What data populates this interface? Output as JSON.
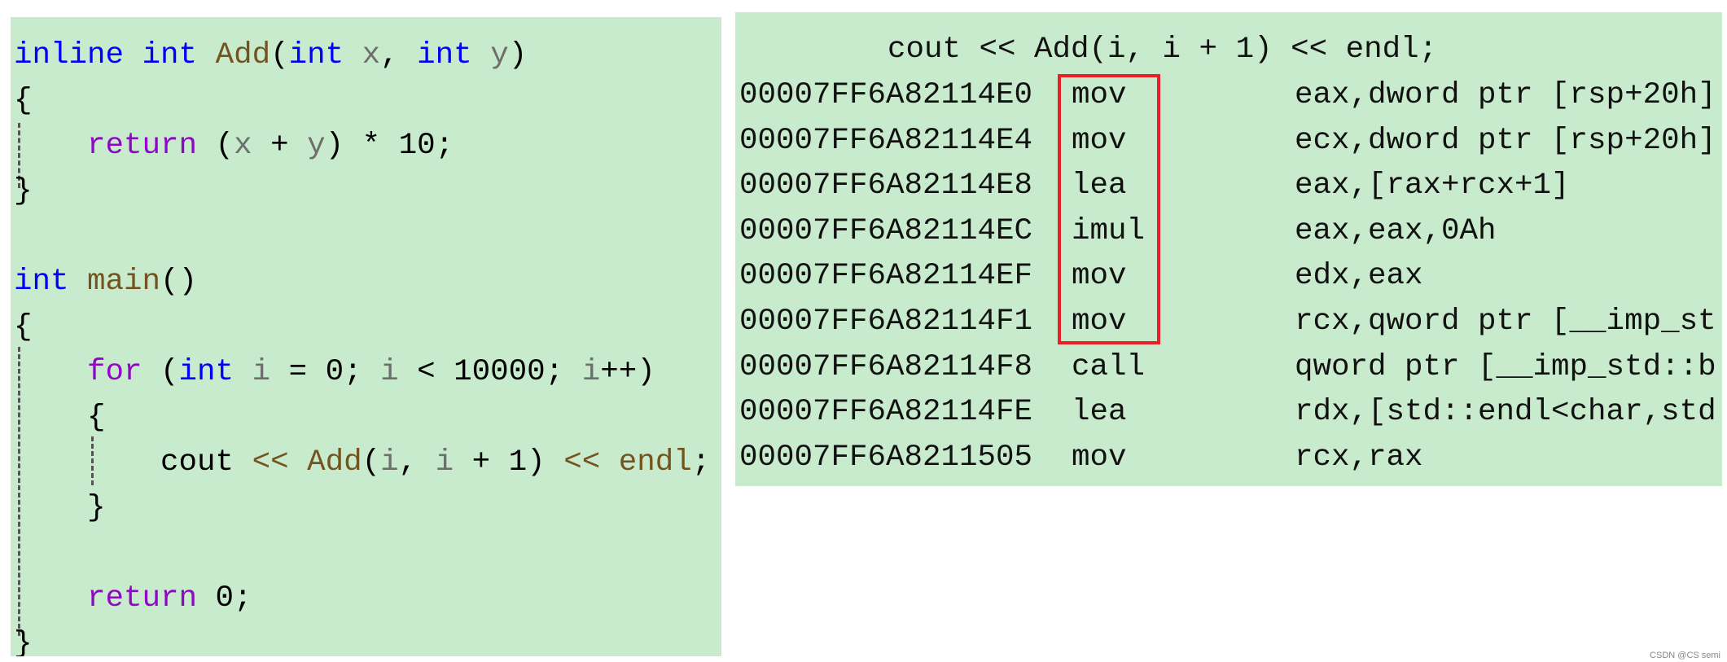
{
  "colors": {
    "background": "#c7ebcc",
    "keyword": "#0000ff",
    "function": "#74531f",
    "control": "#8f08c4",
    "parameter": "#6e6e6e",
    "highlight_box": "#e8202a"
  },
  "source_code": {
    "lines": [
      [
        [
          "inline",
          "kw"
        ],
        [
          " ",
          "pl"
        ],
        [
          "int",
          "kw"
        ],
        [
          " ",
          "pl"
        ],
        [
          "Add",
          "fn"
        ],
        [
          "(",
          "pl"
        ],
        [
          "int",
          "kw"
        ],
        [
          " ",
          "pl"
        ],
        [
          "x",
          "par"
        ],
        [
          ", ",
          "pl"
        ],
        [
          "int",
          "kw"
        ],
        [
          " ",
          "pl"
        ],
        [
          "y",
          "par"
        ],
        [
          ")",
          "pl"
        ]
      ],
      [
        [
          "{",
          "pl"
        ]
      ],
      [
        [
          "    ",
          "pl"
        ],
        [
          "return",
          "ctl"
        ],
        [
          " (",
          "pl"
        ],
        [
          "x",
          "par"
        ],
        [
          " + ",
          "pl"
        ],
        [
          "y",
          "par"
        ],
        [
          ") * 10;",
          "pl"
        ]
      ],
      [
        [
          "}",
          "pl"
        ]
      ],
      [],
      [
        [
          "int",
          "kw"
        ],
        [
          " ",
          "pl"
        ],
        [
          "main",
          "fn"
        ],
        [
          "()",
          "pl"
        ]
      ],
      [
        [
          "{",
          "pl"
        ]
      ],
      [
        [
          "    ",
          "pl"
        ],
        [
          "for",
          "ctl"
        ],
        [
          " (",
          "pl"
        ],
        [
          "int",
          "kw"
        ],
        [
          " ",
          "pl"
        ],
        [
          "i",
          "var"
        ],
        [
          " = 0; ",
          "pl"
        ],
        [
          "i",
          "var"
        ],
        [
          " < 10000; ",
          "pl"
        ],
        [
          "i",
          "var"
        ],
        [
          "++)",
          "pl"
        ]
      ],
      [
        [
          "    {",
          "pl"
        ]
      ],
      [
        [
          "        cout ",
          "pl"
        ],
        [
          "<<",
          "fn"
        ],
        [
          " ",
          "pl"
        ],
        [
          "Add",
          "fn"
        ],
        [
          "(",
          "pl"
        ],
        [
          "i",
          "var"
        ],
        [
          ", ",
          "pl"
        ],
        [
          "i",
          "var"
        ],
        [
          " + 1) ",
          "pl"
        ],
        [
          "<<",
          "fn"
        ],
        [
          " ",
          "pl"
        ],
        [
          "endl",
          "fn"
        ],
        [
          ";",
          "pl"
        ]
      ],
      [
        [
          "    }",
          "pl"
        ]
      ],
      [],
      [
        [
          "    ",
          "pl"
        ],
        [
          "return",
          "ctl"
        ],
        [
          " 0;",
          "pl"
        ]
      ],
      [
        [
          "}",
          "pl"
        ]
      ]
    ]
  },
  "disassembly": {
    "partial_line": "{",
    "source_line": "cout << Add(i, i + 1) << endl;",
    "rows": [
      {
        "address": "00007FF6A82114E0",
        "mnemonic": "mov",
        "operands": "eax,dword ptr [rsp+20h]"
      },
      {
        "address": "00007FF6A82114E4",
        "mnemonic": "mov",
        "operands": "ecx,dword ptr [rsp+20h]"
      },
      {
        "address": "00007FF6A82114E8",
        "mnemonic": "lea",
        "operands": "eax,[rax+rcx+1]"
      },
      {
        "address": "00007FF6A82114EC",
        "mnemonic": "imul",
        "operands": "eax,eax,0Ah"
      },
      {
        "address": "00007FF6A82114EF",
        "mnemonic": "mov",
        "operands": "edx,eax"
      },
      {
        "address": "00007FF6A82114F1",
        "mnemonic": "mov",
        "operands": "rcx,qword ptr [__imp_st"
      },
      {
        "address": "00007FF6A82114F8",
        "mnemonic": "call",
        "operands": "qword ptr [__imp_std::b"
      },
      {
        "address": "00007FF6A82114FE",
        "mnemonic": "lea",
        "operands": "rdx,[std::endl<char,std"
      },
      {
        "address": "00007FF6A8211505",
        "mnemonic": "mov",
        "operands": "rcx,rax"
      }
    ]
  },
  "watermark": "CSDN @CS semi"
}
